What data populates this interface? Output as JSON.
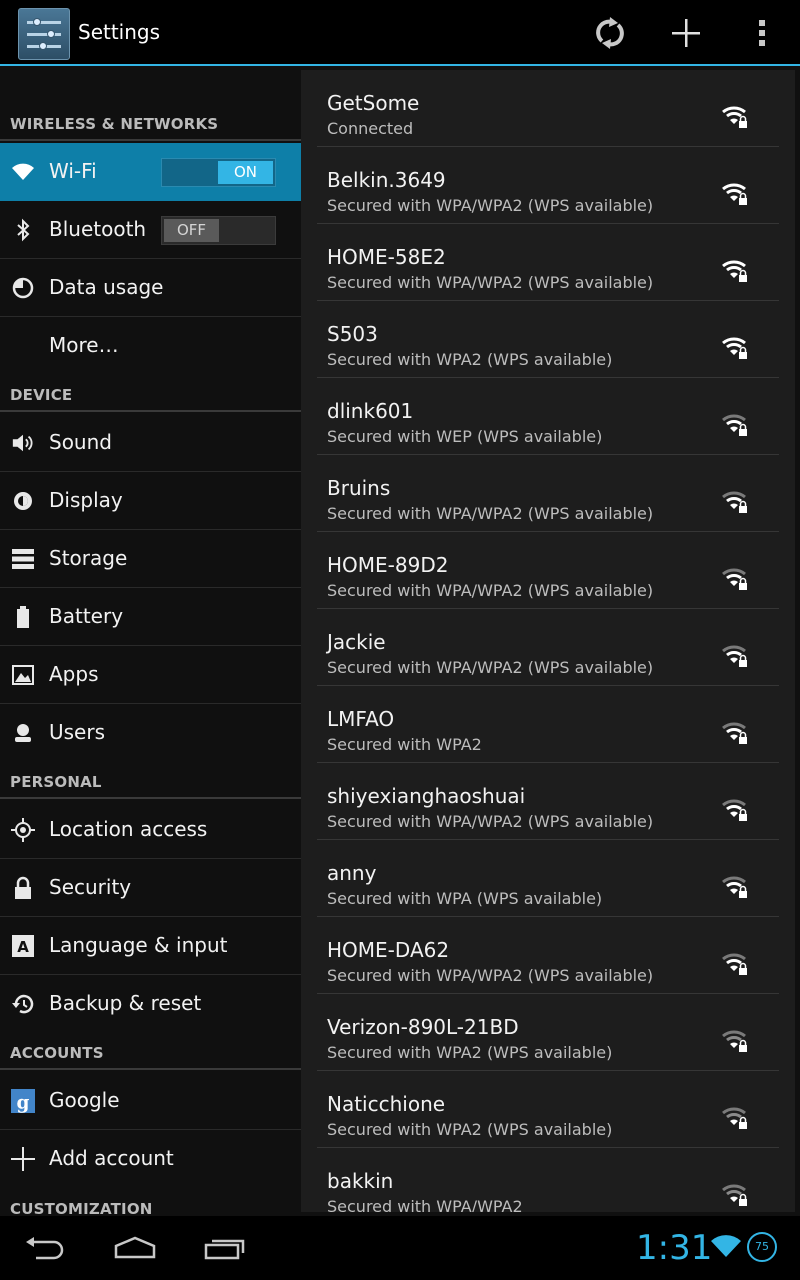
{
  "action_bar": {
    "title": "Settings"
  },
  "sections": [
    {
      "header": "WIRELESS & NETWORKS"
    },
    {
      "header": "DEVICE"
    },
    {
      "header": "PERSONAL"
    },
    {
      "header": "ACCOUNTS"
    },
    {
      "header": "CUSTOMIZATION"
    }
  ],
  "wireless_items": {
    "wifi": {
      "label": "Wi-Fi",
      "toggle": "ON"
    },
    "bluetooth": {
      "label": "Bluetooth",
      "toggle": "OFF"
    },
    "data_usage": {
      "label": "Data usage"
    },
    "more": {
      "label": "More…"
    }
  },
  "device_items": {
    "sound": "Sound",
    "display": "Display",
    "storage": "Storage",
    "battery": "Battery",
    "apps": "Apps",
    "users": "Users"
  },
  "personal_items": {
    "location": "Location access",
    "security": "Security",
    "language": "Language & input",
    "backup": "Backup & reset"
  },
  "account_items": {
    "google": "Google",
    "add_account": "Add account"
  },
  "networks": [
    {
      "ssid": "GetSome",
      "status": "Connected",
      "strength": "full"
    },
    {
      "ssid": "Belkin.3649",
      "status": "Secured with WPA/WPA2 (WPS available)",
      "strength": "full"
    },
    {
      "ssid": "HOME-58E2",
      "status": "Secured with WPA/WPA2 (WPS available)",
      "strength": "full"
    },
    {
      "ssid": "S503",
      "status": "Secured with WPA2 (WPS available)",
      "strength": "full"
    },
    {
      "ssid": "dlink601",
      "status": "Secured with WEP (WPS available)",
      "strength": "medium"
    },
    {
      "ssid": "Bruins",
      "status": "Secured with WPA/WPA2 (WPS available)",
      "strength": "medium"
    },
    {
      "ssid": "HOME-89D2",
      "status": "Secured with WPA/WPA2 (WPS available)",
      "strength": "medium"
    },
    {
      "ssid": "Jackie",
      "status": "Secured with WPA/WPA2 (WPS available)",
      "strength": "medium"
    },
    {
      "ssid": "LMFAO",
      "status": "Secured with WPA2",
      "strength": "medium"
    },
    {
      "ssid": "shiyexianghaoshuai",
      "status": "Secured with WPA/WPA2 (WPS available)",
      "strength": "medium"
    },
    {
      "ssid": "anny",
      "status": "Secured with WPA (WPS available)",
      "strength": "medium"
    },
    {
      "ssid": "HOME-DA62",
      "status": "Secured with WPA/WPA2 (WPS available)",
      "strength": "medium"
    },
    {
      "ssid": "Verizon-890L-21BD",
      "status": "Secured with WPA2 (WPS available)",
      "strength": "weak"
    },
    {
      "ssid": "Naticchione",
      "status": "Secured with WPA2 (WPS available)",
      "strength": "weak"
    },
    {
      "ssid": "bakkin",
      "status": "Secured with WPA/WPA2",
      "strength": "weak"
    }
  ],
  "status_bar": {
    "time": "1:31",
    "battery_level": "75"
  },
  "colors": {
    "accent": "#33b5e5",
    "selected": "#0e7fa8"
  }
}
